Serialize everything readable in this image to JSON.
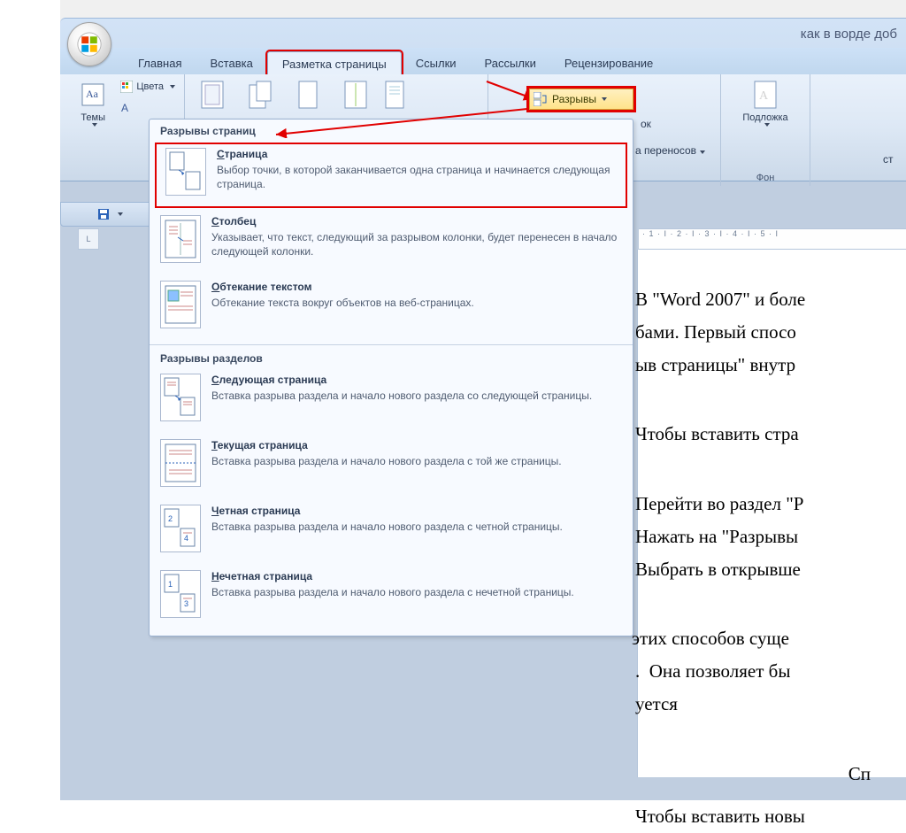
{
  "titlebar": {
    "title": "как в ворде доб"
  },
  "tabs": {
    "home": "Главная",
    "insert": "Вставка",
    "pagelayout": "Разметка страницы",
    "references": "Ссылки",
    "mailings": "Рассылки",
    "review": "Рецензирование"
  },
  "ribbon": {
    "themes": {
      "label": "Темы",
      "colors": "Цвета"
    },
    "breaks_button": "Разрывы",
    "ok_suffix": "ок",
    "hyphenation_suffix": "а переносов",
    "bg_group": "Фон",
    "watermark": "Подложка",
    "st": "ст"
  },
  "breaksMenu": {
    "group1": "Разрывы страниц",
    "group2": "Разрывы разделов",
    "items": {
      "page": {
        "title": "Страница",
        "accel": "С",
        "desc": "Выбор точки, в которой заканчивается одна страница и начинается следующая страница."
      },
      "column": {
        "title": "Столбец",
        "accel": "С",
        "desc": "Указывает, что текст, следующий за разрывом колонки, будет перенесен в начало следующей колонки."
      },
      "textwrap": {
        "title": "Обтекание текстом",
        "accel": "О",
        "desc": "Обтекание текста вокруг объектов на веб-страницах."
      },
      "nextpage": {
        "title": "Следующая страница",
        "accel": "С",
        "desc": "Вставка разрыва раздела и начало нового раздела со следующей страницы."
      },
      "continuous": {
        "title": "Текущая страница",
        "accel": "Т",
        "desc": "Вставка разрыва раздела и начало нового раздела с той же страницы."
      },
      "even": {
        "title": "Четная страница",
        "accel": "Ч",
        "desc": "Вставка разрыва раздела и начало нового раздела с четной страницы."
      },
      "odd": {
        "title": "Нечетная страница",
        "accel": "Н",
        "desc": "Вставка разрыва раздела и начало нового раздела с нечетной страницы."
      }
    }
  },
  "ruler": {
    "segment": " · 1 · І · 2 · І · 3 · І · 4 · І · 5 · І"
  },
  "document": {
    "l1a": "В \"Word 2007\" и боле",
    "l1b": "бами. Первый спосо",
    "l1c": "ыв страницы\" внутр",
    "l2": "Чтобы вставить стра",
    "l3a": "Перейти во раздел \"Р",
    "l3b": "Нажать на \"Разрывы",
    "l3c": "Выбрать в открывше",
    "l4a": "этих способов суще",
    "l4b": ".  Она позволяет бы",
    "l4c": "уется",
    "l5": "Сп",
    "l6": "Чтобы вставить новы"
  }
}
